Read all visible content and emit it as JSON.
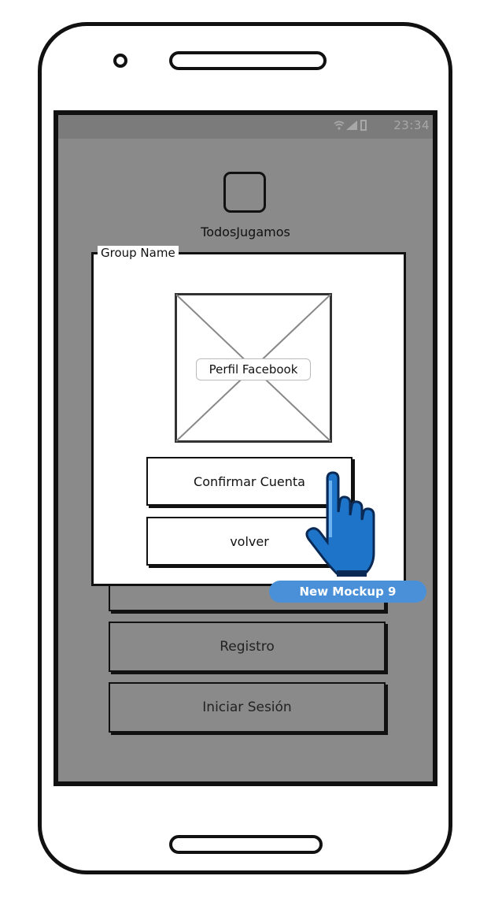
{
  "status_bar": {
    "time": "23:34"
  },
  "app": {
    "title": "TodosJugamos"
  },
  "menu": {
    "register_label": "Registro",
    "login_label": "Iniciar Sesión"
  },
  "dialog": {
    "group_name": "Group Name",
    "image_caption": "Perfil Facebook",
    "confirm_label": "Confirmar Cuenta",
    "back_label": "volver"
  },
  "badge": {
    "label": "New Mockup 9"
  },
  "colors": {
    "screen_bg": "#8a8a8a",
    "statusbar_bg": "#7b7b7b",
    "badge_bg": "#4a90d9",
    "cursor_blue": "#1e74c9"
  },
  "icons": {
    "cursor": "hand-pointer-icon",
    "image": "image-placeholder-icon"
  }
}
